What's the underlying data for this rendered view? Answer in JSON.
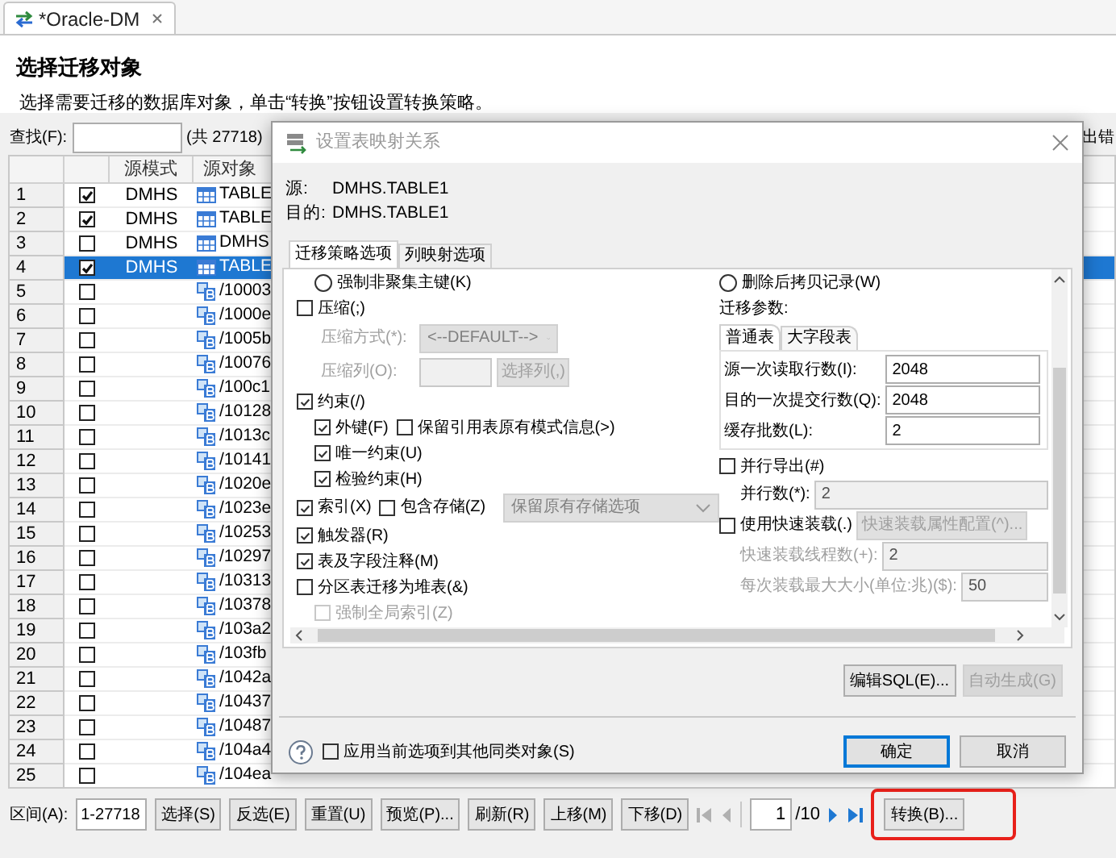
{
  "editor_tab": {
    "title": "*Oracle-DM"
  },
  "header": {
    "title": "选择迁移对象",
    "description": "选择需要迁移的数据库对象，单击“转换”按钮设置转换策略。"
  },
  "find": {
    "label": "查找(F):",
    "count": "(共 27718)",
    "cut_label": "出错"
  },
  "table": {
    "columns": [
      "源模式",
      "源对象"
    ],
    "rows": [
      {
        "number": "1",
        "checked": true,
        "selected": false,
        "schema": "DMHS",
        "object": "TABLE",
        "kind": "table"
      },
      {
        "number": "2",
        "checked": true,
        "selected": false,
        "schema": "DMHS",
        "object": "TABLE",
        "kind": "table"
      },
      {
        "number": "3",
        "checked": false,
        "selected": false,
        "schema": "DMHS",
        "object": "DMHS",
        "kind": "table"
      },
      {
        "number": "4",
        "checked": true,
        "selected": true,
        "schema": "DMHS",
        "object": "TABLE",
        "kind": "table"
      },
      {
        "number": "5",
        "checked": false,
        "selected": false,
        "object": "/10003",
        "kind": "blob"
      },
      {
        "number": "6",
        "checked": false,
        "selected": false,
        "object": "/1000e",
        "kind": "blob"
      },
      {
        "number": "7",
        "checked": false,
        "selected": false,
        "object": "/1005b",
        "kind": "blob"
      },
      {
        "number": "8",
        "checked": false,
        "selected": false,
        "object": "/10076",
        "kind": "blob"
      },
      {
        "number": "9",
        "checked": false,
        "selected": false,
        "object": "/100c1",
        "kind": "blob"
      },
      {
        "number": "10",
        "checked": false,
        "selected": false,
        "object": "/10128",
        "kind": "blob"
      },
      {
        "number": "11",
        "checked": false,
        "selected": false,
        "object": "/1013c",
        "kind": "blob"
      },
      {
        "number": "12",
        "checked": false,
        "selected": false,
        "object": "/10141",
        "kind": "blob"
      },
      {
        "number": "13",
        "checked": false,
        "selected": false,
        "object": "/1020e",
        "kind": "blob"
      },
      {
        "number": "14",
        "checked": false,
        "selected": false,
        "object": "/1023e",
        "kind": "blob"
      },
      {
        "number": "15",
        "checked": false,
        "selected": false,
        "object": "/10253",
        "kind": "blob"
      },
      {
        "number": "16",
        "checked": false,
        "selected": false,
        "object": "/10297",
        "kind": "blob"
      },
      {
        "number": "17",
        "checked": false,
        "selected": false,
        "object": "/10313",
        "kind": "blob"
      },
      {
        "number": "18",
        "checked": false,
        "selected": false,
        "object": "/10378",
        "kind": "blob"
      },
      {
        "number": "19",
        "checked": false,
        "selected": false,
        "object": "/103a2",
        "kind": "blob"
      },
      {
        "number": "20",
        "checked": false,
        "selected": false,
        "object": "/103fb",
        "kind": "blob"
      },
      {
        "number": "21",
        "checked": false,
        "selected": false,
        "object": "/1042a",
        "kind": "blob"
      },
      {
        "number": "22",
        "checked": false,
        "selected": false,
        "object": "/10437",
        "kind": "blob"
      },
      {
        "number": "23",
        "checked": false,
        "selected": false,
        "object": "/10487",
        "kind": "blob"
      },
      {
        "number": "24",
        "checked": false,
        "selected": false,
        "object": "/104a4",
        "kind": "blob"
      },
      {
        "number": "25",
        "checked": false,
        "selected": false,
        "object": "/104ea",
        "kind": "blob"
      }
    ]
  },
  "toolbar": {
    "range_label": "区间(A):",
    "range_value": "1-27718",
    "buttons": [
      "选择(S)",
      "反选(E)",
      "重置(U)",
      "预览(P)...",
      "刷新(R)",
      "上移(M)",
      "下移(D)"
    ],
    "page": "1",
    "page_total": "/10",
    "convert": {
      "label": "转换(B)...",
      "highlighted": true
    }
  },
  "dialog": {
    "title": "设置表映射关系",
    "source_label": "源:",
    "source": "DMHS.TABLE1",
    "target_label": "目的:",
    "target": "DMHS.TABLE1",
    "tabs": [
      {
        "label": "迁移策略选项",
        "selected": true
      },
      {
        "label": "列映射选项",
        "selected": false
      }
    ],
    "left": [
      {
        "children": [
          {
            "items": [
              {
                "kind": "radio",
                "label": "强制非聚集主键(K)",
                "selected": false
              }
            ]
          }
        ]
      },
      {
        "items": [
          {
            "kind": "checkbox",
            "label": "压缩(;)",
            "checked": false
          }
        ],
        "children": [
          {
            "items": [
              {
                "kind": "label",
                "label": "压缩方式(*):",
                "disabled": true
              },
              {
                "kind": "select",
                "value": "<--DEFAULT-->",
                "disabled": true
              }
            ]
          },
          {
            "items": [
              {
                "kind": "label",
                "label": "压缩列(O):",
                "disabled": true
              },
              {
                "kind": "field",
                "value": "",
                "disabled": true
              },
              {
                "kind": "button",
                "label": "选择列(,)",
                "disabled": true
              }
            ]
          }
        ]
      },
      {
        "items": [
          {
            "kind": "checkbox",
            "label": "约束(/)",
            "checked": true
          }
        ],
        "children": [
          {
            "items": [
              {
                "kind": "checkbox",
                "label": "外键(F)",
                "checked": true
              },
              {
                "kind": "checkbox",
                "label": "保留引用表原有模式信息(>)",
                "checked": false
              }
            ]
          },
          {
            "items": [
              {
                "kind": "checkbox",
                "label": "唯一约束(U)",
                "checked": true
              }
            ]
          },
          {
            "items": [
              {
                "kind": "checkbox",
                "label": "检验约束(H)",
                "checked": true
              }
            ]
          }
        ]
      },
      {
        "items": [
          {
            "kind": "checkbox",
            "label": "索引(X)",
            "checked": true
          },
          {
            "kind": "checkbox",
            "label": "包含存储(Z)",
            "checked": false
          },
          {
            "kind": "select",
            "value": "保留原有存储选项",
            "disabled": true
          }
        ]
      },
      {
        "items": [
          {
            "kind": "checkbox",
            "label": "触发器(R)",
            "checked": true
          }
        ]
      },
      {
        "items": [
          {
            "kind": "checkbox",
            "label": "表及字段注释(M)",
            "checked": true
          }
        ]
      },
      {
        "items": [
          {
            "kind": "checkbox",
            "label": "分区表迁移为堆表(&)",
            "checked": false
          }
        ],
        "children": [
          {
            "items": [
              {
                "kind": "checkbox",
                "label": "强制全局索引(Z)",
                "checked": false,
                "disabled": true
              }
            ]
          }
        ]
      }
    ],
    "right_top": [
      {
        "items": [
          {
            "kind": "radio",
            "label": "删除后拷贝记录(W)",
            "selected": false
          }
        ]
      },
      {
        "items": [
          {
            "kind": "label",
            "label": "迁移参数:"
          }
        ]
      }
    ],
    "param_tabs": [
      {
        "label": "普通表",
        "selected": true
      },
      {
        "label": "大字段表",
        "selected": false
      }
    ],
    "params": [
      {
        "label": "源一次读取行数(I):",
        "value": "2048"
      },
      {
        "label": "目的一次提交行数(Q):",
        "value": "2048"
      },
      {
        "label": "缓存批数(L):",
        "value": "2"
      }
    ],
    "right_bottom": [
      {
        "items": [
          {
            "kind": "checkbox",
            "label": "并行导出(#)",
            "checked": false
          }
        ],
        "children": [
          {
            "items": [
              {
                "kind": "label",
                "label": "并行数(*):"
              },
              {
                "kind": "field",
                "value": "2",
                "disabled": true
              }
            ]
          }
        ]
      },
      {
        "items": [
          {
            "kind": "checkbox",
            "label": "使用快速装载(.)",
            "checked": false
          },
          {
            "kind": "button",
            "label": "快速装载属性配置(^)...",
            "disabled": true
          }
        ],
        "children": [
          {
            "items": [
              {
                "kind": "label",
                "label": "快速装载线程数(+):",
                "disabled": true
              },
              {
                "kind": "field",
                "value": "2",
                "disabled": true
              }
            ]
          },
          {
            "items": [
              {
                "kind": "label",
                "label": "每次装载最大大小(单位:兆)($):",
                "disabled": true
              },
              {
                "kind": "field",
                "value": "50",
                "disabled": true
              }
            ]
          }
        ]
      }
    ],
    "actions": [
      {
        "label": "编辑SQL(E)...",
        "disabled": false
      },
      {
        "label": "自动生成(G)",
        "disabled": true
      }
    ],
    "apply_all": {
      "label": "应用当前选项到其他同类对象(S)",
      "checked": false
    },
    "buttons": [
      {
        "label": "确定",
        "default": true
      },
      {
        "label": "取消",
        "default": false
      }
    ]
  }
}
